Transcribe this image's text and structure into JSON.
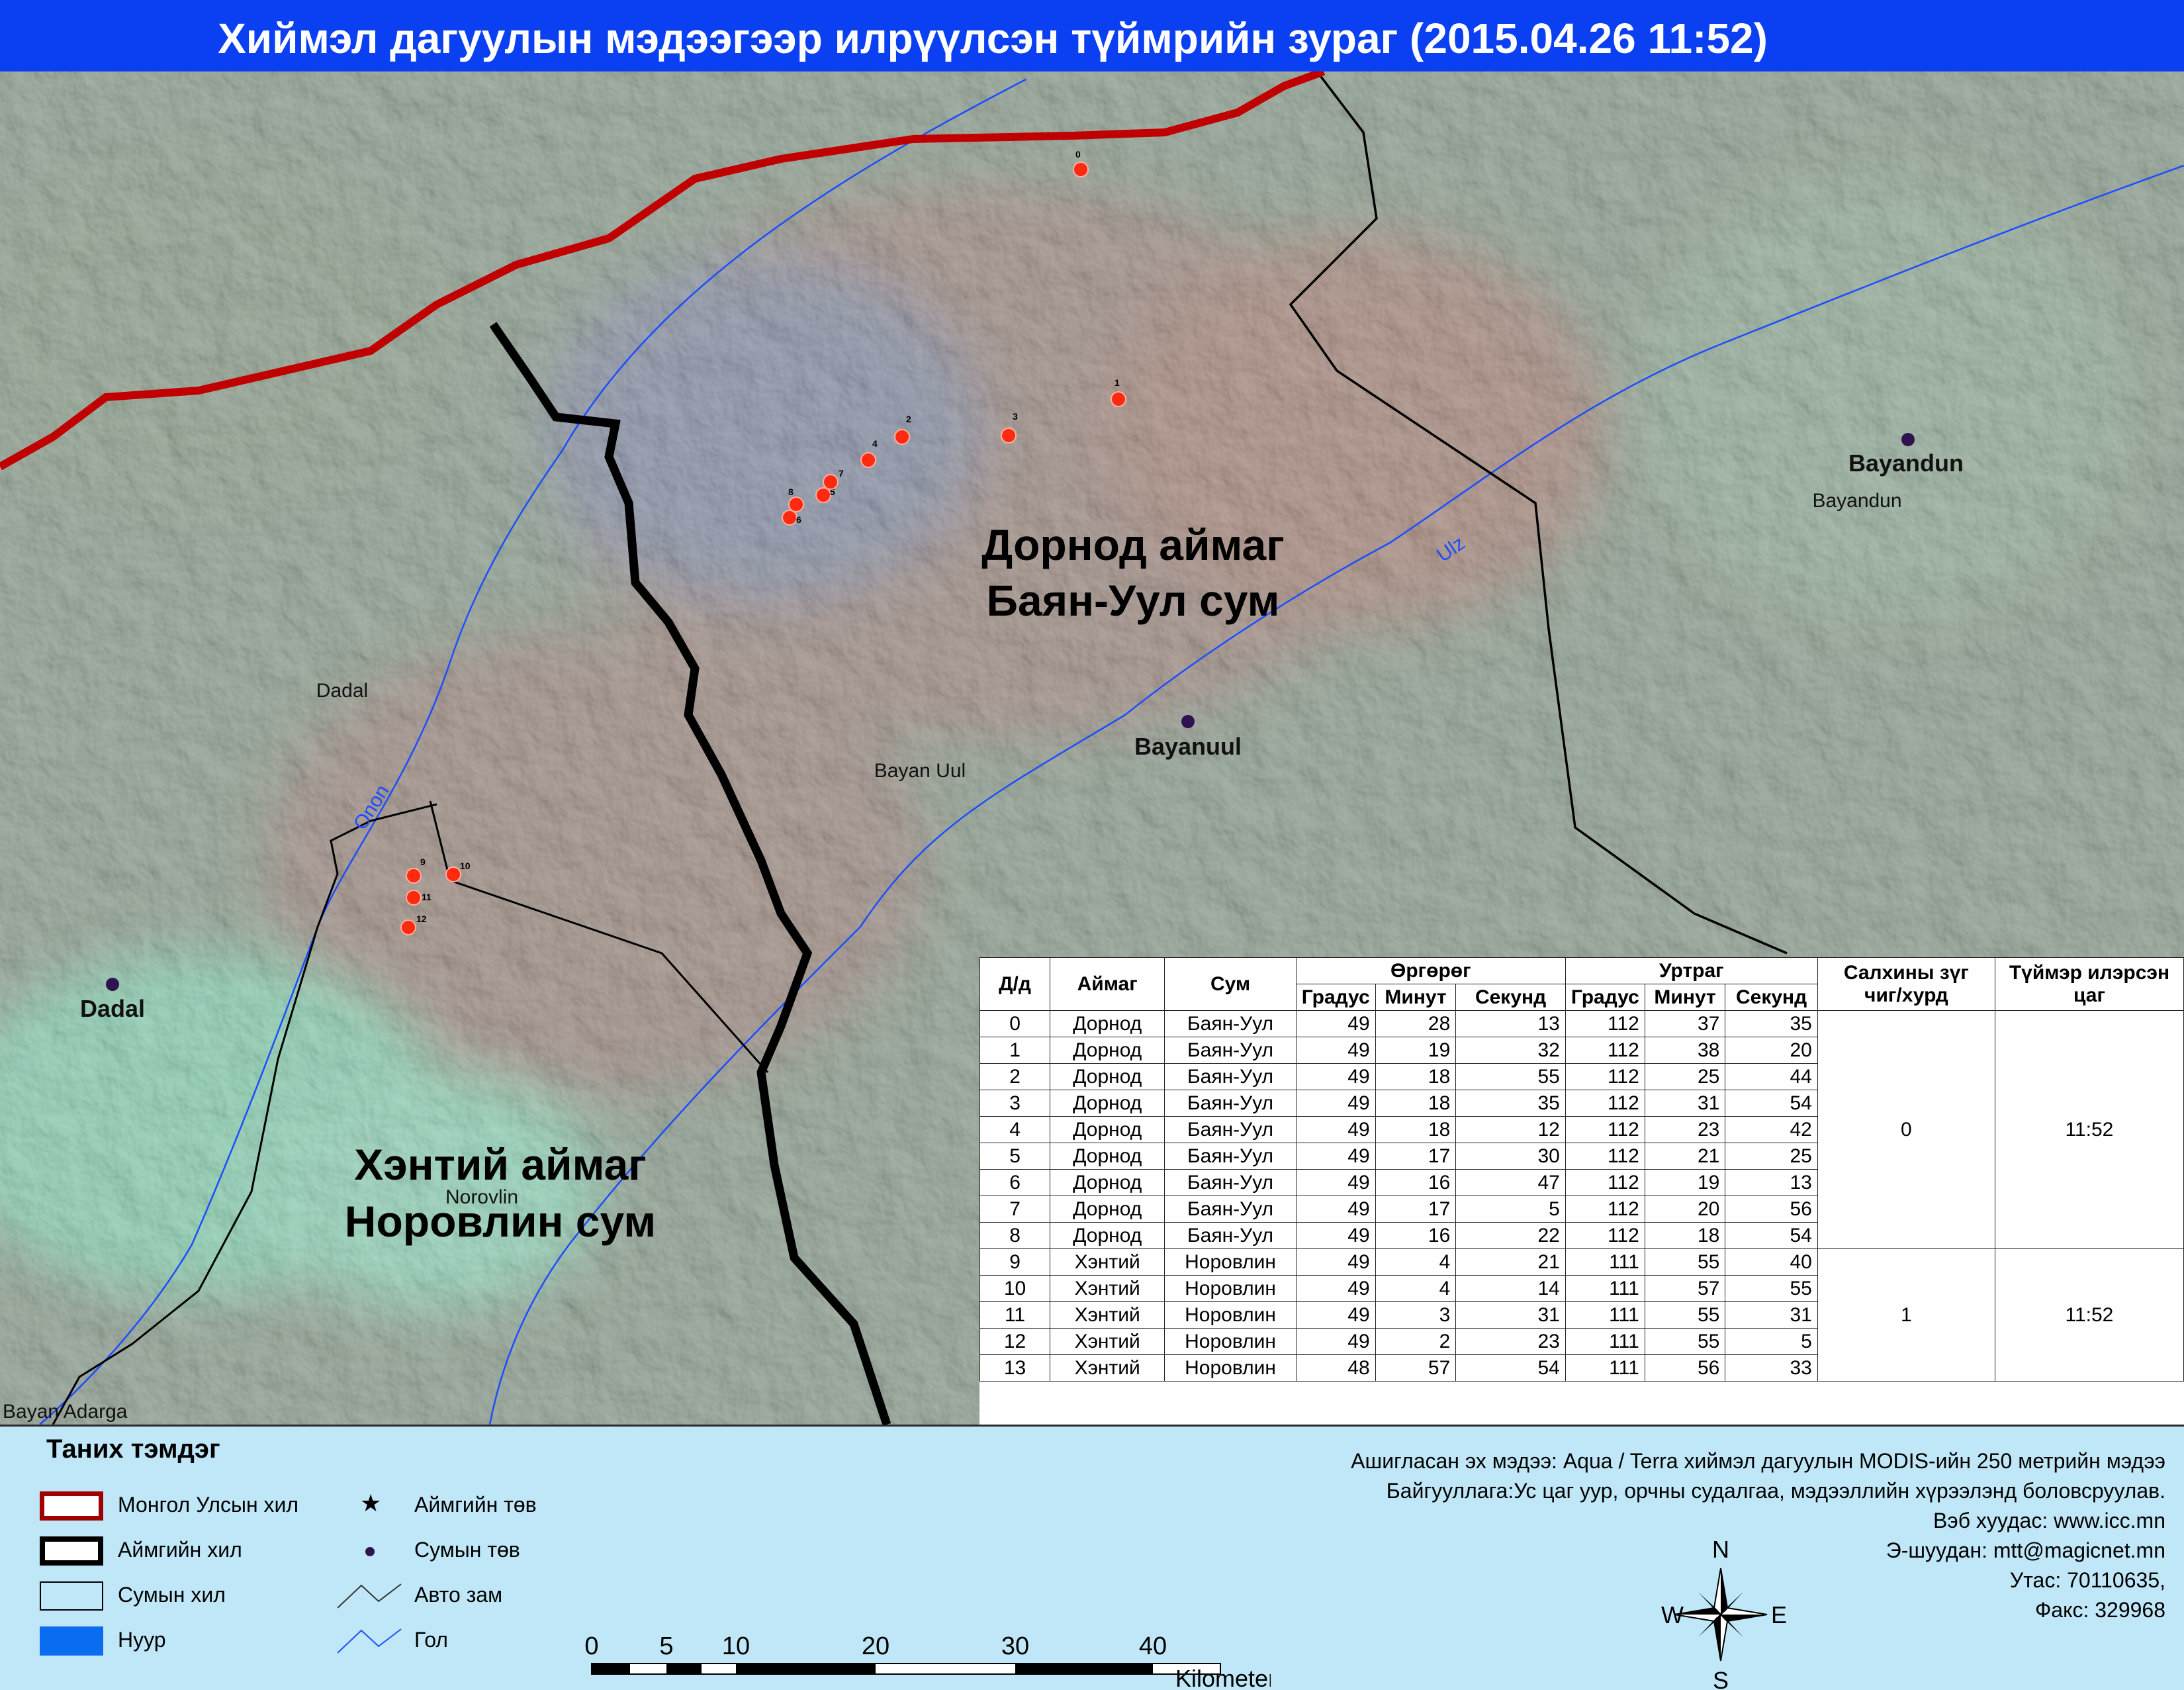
{
  "title": "Хиймэл дагуулын мэдээгээр илрүүлсэн түймрийн зураг  (2015.04.26 11:52)",
  "map": {
    "regions": [
      {
        "id": "dornod",
        "line1": "Дорнод аймаг",
        "line2": "Баян-Уул сум"
      },
      {
        "id": "khentii",
        "line1": "Хэнтий аймаг",
        "line2": "Норовлин сум"
      }
    ],
    "towns": [
      {
        "id": "bayandun",
        "name": "Bayandun",
        "place_label": "Bayandun"
      },
      {
        "id": "bayanuul",
        "name": "Bayanuul",
        "place_label": "Bayan Uul"
      },
      {
        "id": "dadal",
        "name": "Dadal",
        "place_label": "Dadal"
      }
    ],
    "places": {
      "norovlin": "Norovlin",
      "bayan_adarga": "Bayan Adarga"
    },
    "rivers": {
      "ulz": "Ulz",
      "onon": "Onon"
    },
    "fire_ids": [
      "0",
      "1",
      "2",
      "3",
      "4",
      "5",
      "6",
      "7",
      "8",
      "9",
      "10",
      "11",
      "12"
    ],
    "colors": {
      "national_border": "#c00000",
      "province_border": "#000000",
      "fire": "#ff2a10",
      "river": "#1a4dff",
      "sum_center": "#2e1350"
    }
  },
  "table": {
    "headers": {
      "id": "Д/д",
      "aimag": "Аймаг",
      "sum": "Сум",
      "lat": "Өргөрөг",
      "lon": "Уртраг",
      "deg": "Градус",
      "min": "Минут",
      "sec": "Секунд",
      "wind": "Салхины зүг чиг/хурд",
      "time": "Түймэр илэрсэн цаг"
    },
    "rows": [
      {
        "id": "0",
        "aimag": "Дорнод",
        "sum": "Баян-Уул",
        "lat_d": "49",
        "lat_m": "28",
        "lat_s": "13",
        "lon_d": "112",
        "lon_m": "37",
        "lon_s": "35"
      },
      {
        "id": "1",
        "aimag": "Дорнод",
        "sum": "Баян-Уул",
        "lat_d": "49",
        "lat_m": "19",
        "lat_s": "32",
        "lon_d": "112",
        "lon_m": "38",
        "lon_s": "20"
      },
      {
        "id": "2",
        "aimag": "Дорнод",
        "sum": "Баян-Уул",
        "lat_d": "49",
        "lat_m": "18",
        "lat_s": "55",
        "lon_d": "112",
        "lon_m": "25",
        "lon_s": "44"
      },
      {
        "id": "3",
        "aimag": "Дорнод",
        "sum": "Баян-Уул",
        "lat_d": "49",
        "lat_m": "18",
        "lat_s": "35",
        "lon_d": "112",
        "lon_m": "31",
        "lon_s": "54"
      },
      {
        "id": "4",
        "aimag": "Дорнод",
        "sum": "Баян-Уул",
        "lat_d": "49",
        "lat_m": "18",
        "lat_s": "12",
        "lon_d": "112",
        "lon_m": "23",
        "lon_s": "42"
      },
      {
        "id": "5",
        "aimag": "Дорнод",
        "sum": "Баян-Уул",
        "lat_d": "49",
        "lat_m": "17",
        "lat_s": "30",
        "lon_d": "112",
        "lon_m": "21",
        "lon_s": "25"
      },
      {
        "id": "6",
        "aimag": "Дорнод",
        "sum": "Баян-Уул",
        "lat_d": "49",
        "lat_m": "16",
        "lat_s": "47",
        "lon_d": "112",
        "lon_m": "19",
        "lon_s": "13"
      },
      {
        "id": "7",
        "aimag": "Дорнод",
        "sum": "Баян-Уул",
        "lat_d": "49",
        "lat_m": "17",
        "lat_s": "5",
        "lon_d": "112",
        "lon_m": "20",
        "lon_s": "56"
      },
      {
        "id": "8",
        "aimag": "Дорнод",
        "sum": "Баян-Уул",
        "lat_d": "49",
        "lat_m": "16",
        "lat_s": "22",
        "lon_d": "112",
        "lon_m": "18",
        "lon_s": "54"
      },
      {
        "id": "9",
        "aimag": "Хэнтий",
        "sum": "Норовлин",
        "lat_d": "49",
        "lat_m": "4",
        "lat_s": "21",
        "lon_d": "111",
        "lon_m": "55",
        "lon_s": "40"
      },
      {
        "id": "10",
        "aimag": "Хэнтий",
        "sum": "Норовлин",
        "lat_d": "49",
        "lat_m": "4",
        "lat_s": "14",
        "lon_d": "111",
        "lon_m": "57",
        "lon_s": "55"
      },
      {
        "id": "11",
        "aimag": "Хэнтий",
        "sum": "Норовлин",
        "lat_d": "49",
        "lat_m": "3",
        "lat_s": "31",
        "lon_d": "111",
        "lon_m": "55",
        "lon_s": "31"
      },
      {
        "id": "12",
        "aimag": "Хэнтий",
        "sum": "Норовлин",
        "lat_d": "49",
        "lat_m": "2",
        "lat_s": "23",
        "lon_d": "111",
        "lon_m": "55",
        "lon_s": "5"
      },
      {
        "id": "13",
        "aimag": "Хэнтий",
        "sum": "Норовлин",
        "lat_d": "48",
        "lat_m": "57",
        "lat_s": "54",
        "lon_d": "111",
        "lon_m": "56",
        "lon_s": "33"
      }
    ],
    "groups": [
      {
        "wind": "0",
        "time": "11:52"
      },
      {
        "wind": "1",
        "time": "11:52"
      }
    ]
  },
  "legend": {
    "title": "Таних тэмдэг",
    "items": {
      "national_border": "Монгол Улсын хил",
      "province_border": "Аймгийн хил",
      "sum_border": "Сумын хил",
      "lake": "Нуур",
      "province_center": "Аймгийн төв",
      "sum_center": "Сумын төв",
      "road": "Авто зам",
      "river": "Гол"
    }
  },
  "info": {
    "source": "Ашигласан эх мэдээ: Aqua / Terra хиймэл дагуулын MODIS-ийн 250 метрийн мэдээ",
    "org": "Байгууллага:Ус цаг уур, орчны судалгаа, мэдээллийн хүрээлэнд боловсруулав.",
    "web": "Вэб хуудас: www.icc.mn",
    "email": "Э-шуудан: mtt@magicnet.mn",
    "phone": "Утас: 70110635,",
    "fax": "Факс: 329968"
  },
  "scalebar": {
    "ticks": [
      "0",
      "5",
      "10",
      "20",
      "30",
      "40"
    ],
    "unit": "Kilometers"
  },
  "compass": {
    "n": "N",
    "s": "S",
    "e": "E",
    "w": "W"
  }
}
